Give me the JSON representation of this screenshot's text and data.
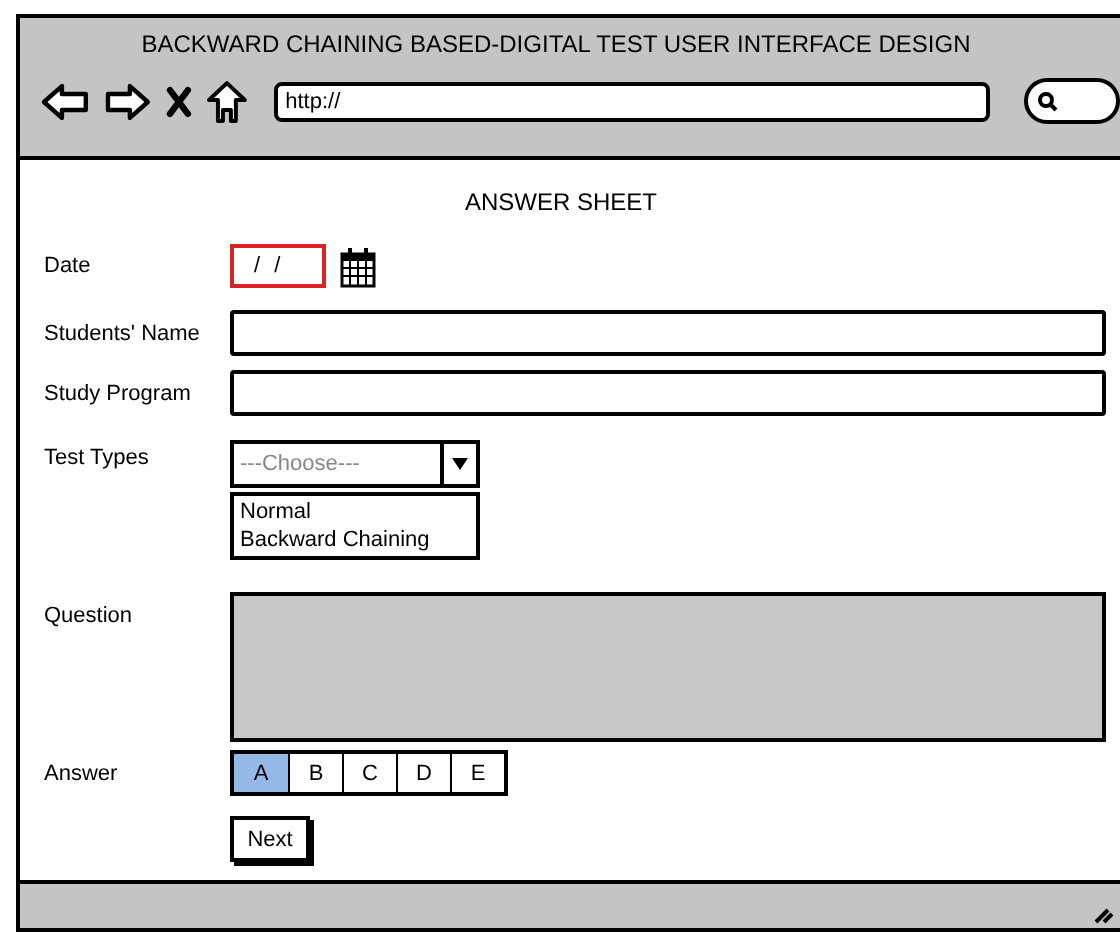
{
  "window": {
    "title": "BACKWARD CHAINING BASED-DIGITAL TEST USER INTERFACE DESIGN"
  },
  "address_bar": {
    "value": "http://"
  },
  "page": {
    "heading": "ANSWER SHEET",
    "fields": [
      {
        "kind": "date",
        "label": "Date",
        "value": "/ /",
        "invalid": true
      },
      {
        "kind": "text",
        "label": "Students' Name"
      },
      {
        "kind": "text",
        "label": "Study Program"
      },
      {
        "kind": "select",
        "label": "Test Types",
        "placeholder": "---Choose---",
        "options": [
          "Normal",
          "Backward Chaining"
        ]
      },
      {
        "kind": "textarea",
        "label": "Question"
      },
      {
        "kind": "choice",
        "label": "Answer",
        "options": [
          {
            "label": "A",
            "selected": true
          },
          {
            "label": "B",
            "selected": false
          },
          {
            "label": "C",
            "selected": false
          },
          {
            "label": "D",
            "selected": false
          },
          {
            "label": "E",
            "selected": false
          }
        ]
      }
    ],
    "buttons": [
      "Next"
    ]
  }
}
